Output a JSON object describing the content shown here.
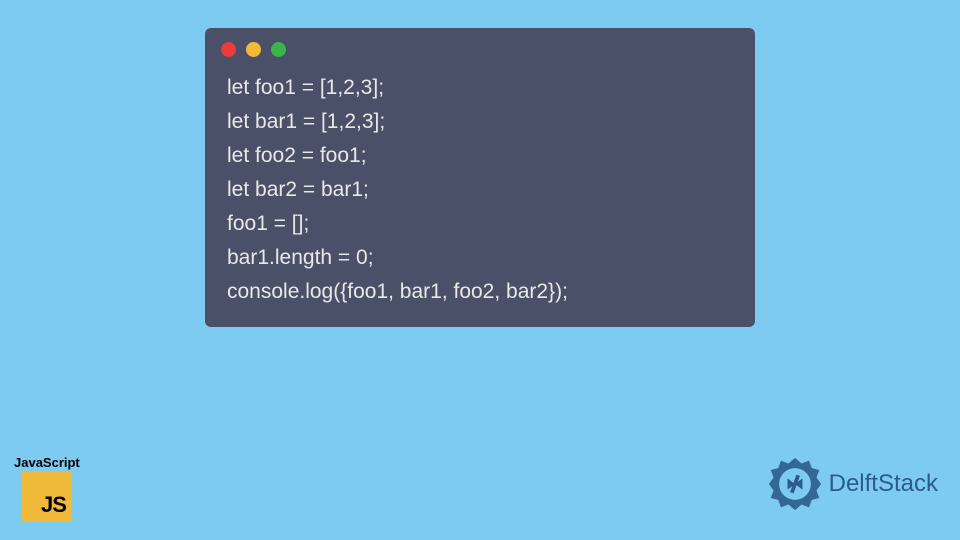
{
  "code": {
    "lines": [
      "let foo1 = [1,2,3];",
      "let bar1 = [1,2,3];",
      "let foo2 = foo1;",
      "let bar2 = bar1;",
      "foo1 = [];",
      "bar1.length = 0;",
      "console.log({foo1, bar1, foo2, bar2});"
    ]
  },
  "badges": {
    "js_label": "JavaScript",
    "js_text": "JS",
    "delft_text": "DelftStack"
  }
}
